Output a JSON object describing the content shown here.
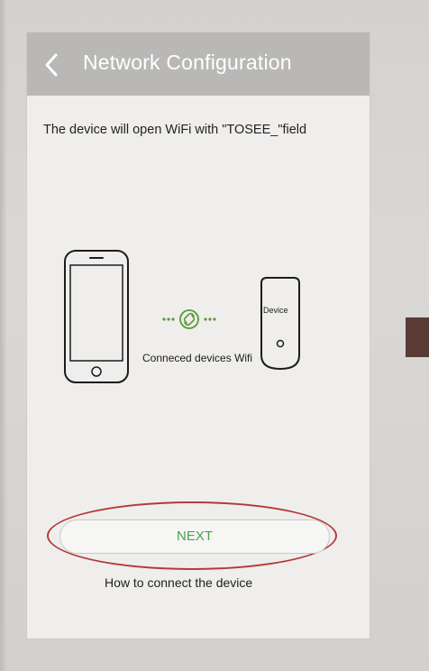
{
  "header": {
    "title": "Network Configuration",
    "back_icon": "chevron-left-icon"
  },
  "main": {
    "info_text": "The device will open WiFi with \"TOSEE_\"field",
    "illustration": {
      "connection_label": "Conneced devices Wifi",
      "device_label": "Device",
      "icons": [
        "smartphone-icon",
        "link-icon",
        "device-icon"
      ]
    },
    "next_label": "NEXT",
    "help_link": "How to connect the device"
  },
  "colors": {
    "header_bg": "#b9b8b6",
    "accent_green": "#45a44a",
    "highlight_red": "#b43a3a"
  }
}
